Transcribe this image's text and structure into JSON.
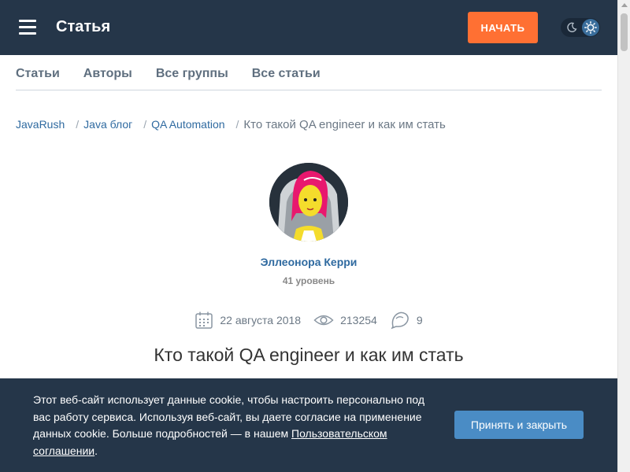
{
  "header": {
    "title": "Статья",
    "start_label": "НАЧАТЬ",
    "colors": {
      "bar": "#253649",
      "accent": "#ff7033"
    }
  },
  "tabs": [
    {
      "label": "Статьи"
    },
    {
      "label": "Авторы"
    },
    {
      "label": "Все группы"
    },
    {
      "label": "Все статьи"
    }
  ],
  "breadcrumb": {
    "items": [
      "JavaRush",
      "Java блог",
      "QA Automation"
    ],
    "current": "Кто такой QA engineer и как им стать"
  },
  "author": {
    "name": "Эллеонора Керри",
    "level": "41 уровень"
  },
  "meta": {
    "date": "22 августа 2018",
    "views": "213254",
    "comments": "9"
  },
  "article": {
    "title": "Кто такой QA engineer и как им стать"
  },
  "cookie": {
    "text": "Этот веб-сайт использует данные cookie, чтобы настроить персонально под вас работу сервиса. Используя веб-сайт, вы даете согласие на применение данных cookie. Больше подробностей — в нашем ",
    "link": "Пользовательском соглашении",
    "end": ".",
    "accept_label": "Принять и закрыть"
  }
}
